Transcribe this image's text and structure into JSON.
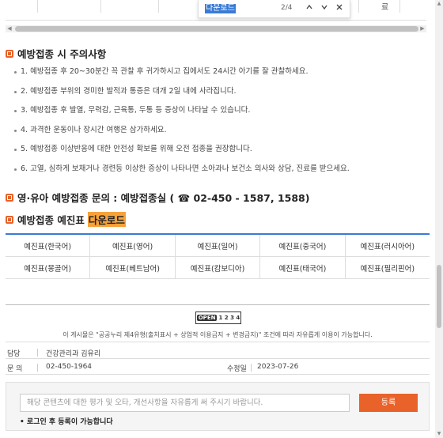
{
  "find_bar": {
    "query": "다운로드",
    "match_count": "2/4",
    "prev_icon": "chevron-up-icon",
    "next_icon": "chevron-down-icon",
    "close_icon": "close-icon"
  },
  "top_table": {
    "partial_cell": "료"
  },
  "precautions": {
    "title": "예방접종 시 주의사항",
    "items": [
      "1. 예방접종 후 20~30분간 꼭 관찰 후 귀가하시고 집에서도 24시간 아기를 잘 관찰하세요.",
      "2. 예방접종 부위의 경미한 발적과 통증은 대개 2일 내에 사라집니다.",
      "3. 예방접종 후 발열, 무력감, 근육통, 두통 등 증상이 나타날 수 있습니다.",
      "4. 과격한 운동이나 장시간 여행은 삼가하세요.",
      "5. 예방접종 이상반응에 대한 안전성 확보를 위해 오전 접종을 권장합니다.",
      "6. 고열, 심하게 보채거나 경련등 이상한 증상이 나타나면 소아과나 보건소 의사와 상담, 진료를 받으세요."
    ]
  },
  "inquiry": {
    "title": "영·유아 예방접종 문의 : 예방접종실 ( ☎ 02-450 - 1587, 1588)"
  },
  "download": {
    "title_prefix": "예방접종 예진표",
    "title_highlight": "다운로드"
  },
  "languages": [
    [
      "예진표(한국어)",
      "예진표(영어)",
      "예진표(일어)",
      "예진표(중국어)",
      "예진표(러시아어)"
    ],
    [
      "예진표(몽골어)",
      "예진표(베트남어)",
      "예진표(캄보디아)",
      "예진표(태국어)",
      "예진표(필리핀어)"
    ]
  ],
  "license": {
    "badge_open": "OPEN",
    "badge_marks": "1 2 3 4",
    "text": "이 게시물은 \"공공누리 제4유형(출처표시 + 상업적 이용금지 + 변경금지)\" 조건에 따라 자유롭게 이용이 가능합니다."
  },
  "info": {
    "manager_label": "담당",
    "manager_value": "건강관리과 김유리",
    "phone_label": "문 의",
    "phone_value": "02-450-1964",
    "modified_label": "수정일",
    "modified_value": "2023-07-26"
  },
  "feedback": {
    "placeholder": "해당 콘텐츠에 대한 평가 및 오타, 개선사항을 자유롭게 써 주시기 바랍니다.",
    "submit_label": "등록",
    "login_note": "• 로그인 후 등록이 가능합니다"
  },
  "colors": {
    "accent": "#e8622a",
    "highlight": "#f6a23a",
    "grid_top": "#3a7bd5"
  }
}
